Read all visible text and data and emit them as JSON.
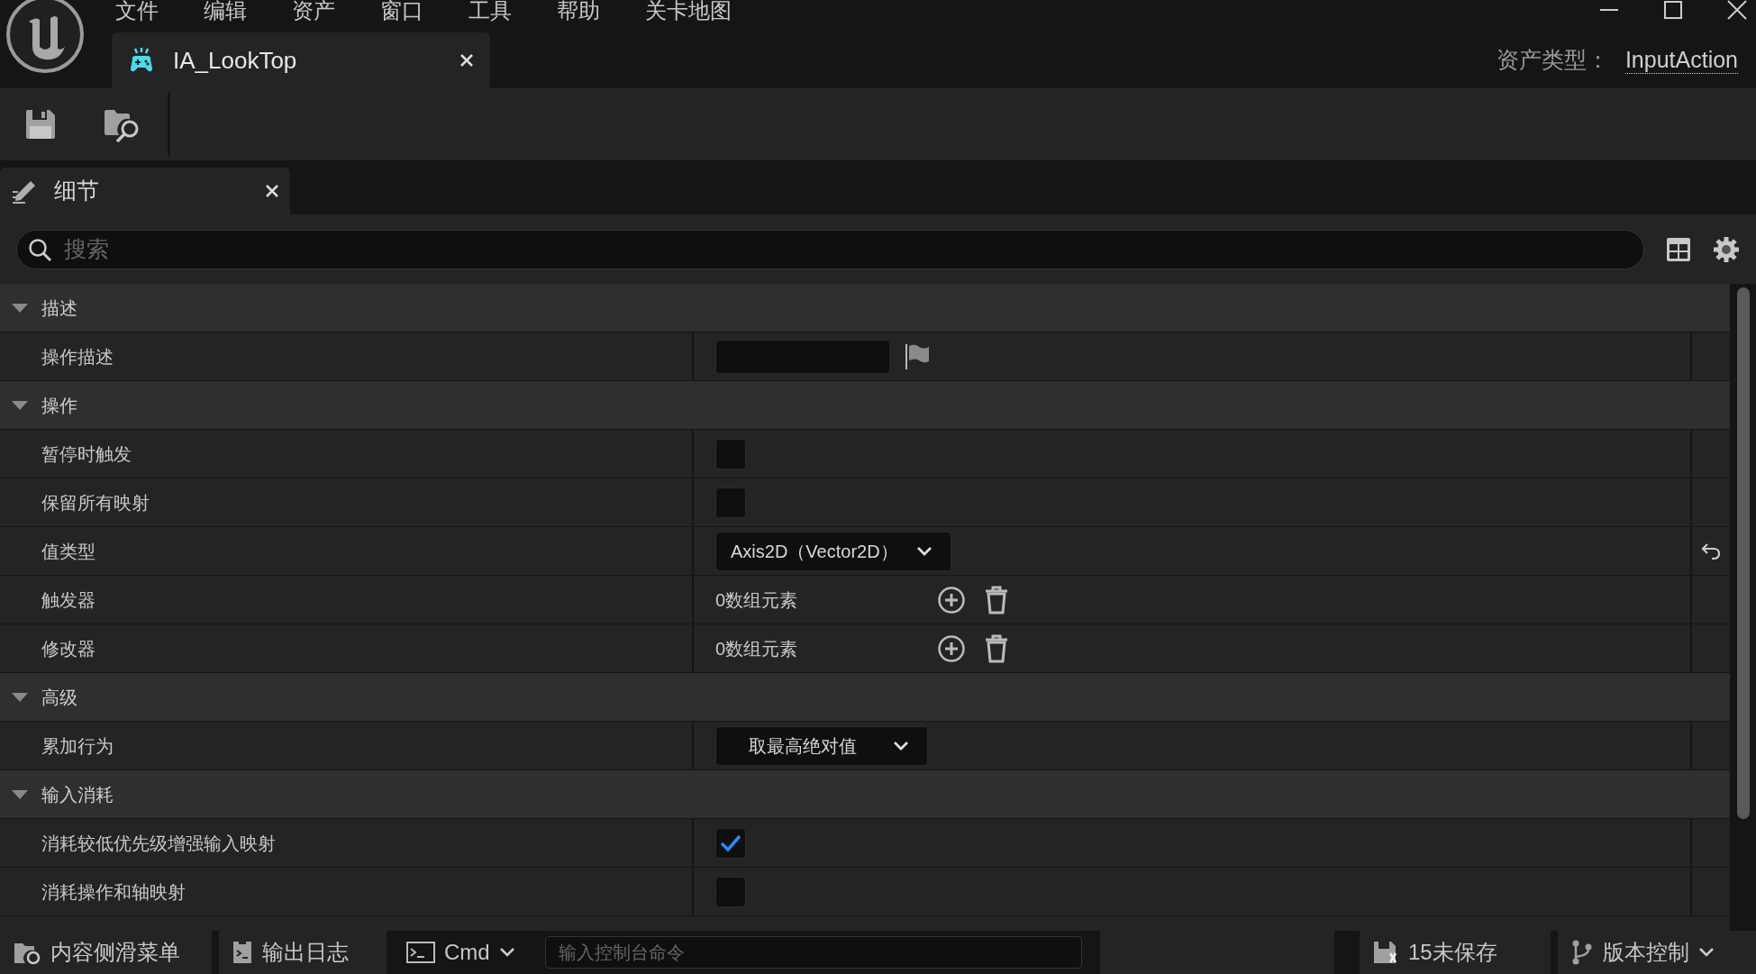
{
  "menu": [
    "文件",
    "编辑",
    "资产",
    "窗口",
    "工具",
    "帮助",
    "关卡地图"
  ],
  "document_tab": {
    "title": "IA_LookTop"
  },
  "asset_type": {
    "label": "资产类型：",
    "value": "InputAction"
  },
  "details_tab": {
    "title": "细节"
  },
  "search": {
    "placeholder": "搜索"
  },
  "sections": [
    {
      "title": "描述",
      "expanded": true,
      "rows": [
        {
          "label": "操作描述",
          "kind": "text",
          "reset": false
        }
      ]
    },
    {
      "title": "操作",
      "expanded": true,
      "rows": [
        {
          "label": "暂停时触发",
          "kind": "checkbox",
          "checked": false,
          "reset": false
        },
        {
          "label": "保留所有映射",
          "kind": "checkbox",
          "checked": false,
          "reset": false
        },
        {
          "label": "值类型",
          "kind": "dropdown",
          "value": "Axis2D（Vector2D）",
          "reset": true
        },
        {
          "label": "触发器",
          "kind": "array",
          "value": "0数组元素",
          "reset": false
        },
        {
          "label": "修改器",
          "kind": "array",
          "value": "0数组元素",
          "reset": false
        }
      ]
    },
    {
      "title": "高级",
      "expanded": true,
      "rows": [
        {
          "label": "累加行为",
          "kind": "dropdown",
          "value": "取最高绝对值",
          "reset": false
        }
      ]
    },
    {
      "title": "输入消耗",
      "expanded": true,
      "rows": [
        {
          "label": "消耗较低优先级增强输入映射",
          "kind": "checkbox",
          "checked": true,
          "reset": false
        },
        {
          "label": "消耗操作和轴映射",
          "kind": "checkbox",
          "checked": false,
          "reset": false
        }
      ]
    }
  ],
  "bottom_bar": {
    "content_drawer": "内容侧滑菜单",
    "output_log": "输出日志",
    "cmd": "Cmd",
    "console": {
      "placeholder": "输入控制台命令"
    },
    "unsaved": "15未保存",
    "source_control": "版本控制"
  }
}
